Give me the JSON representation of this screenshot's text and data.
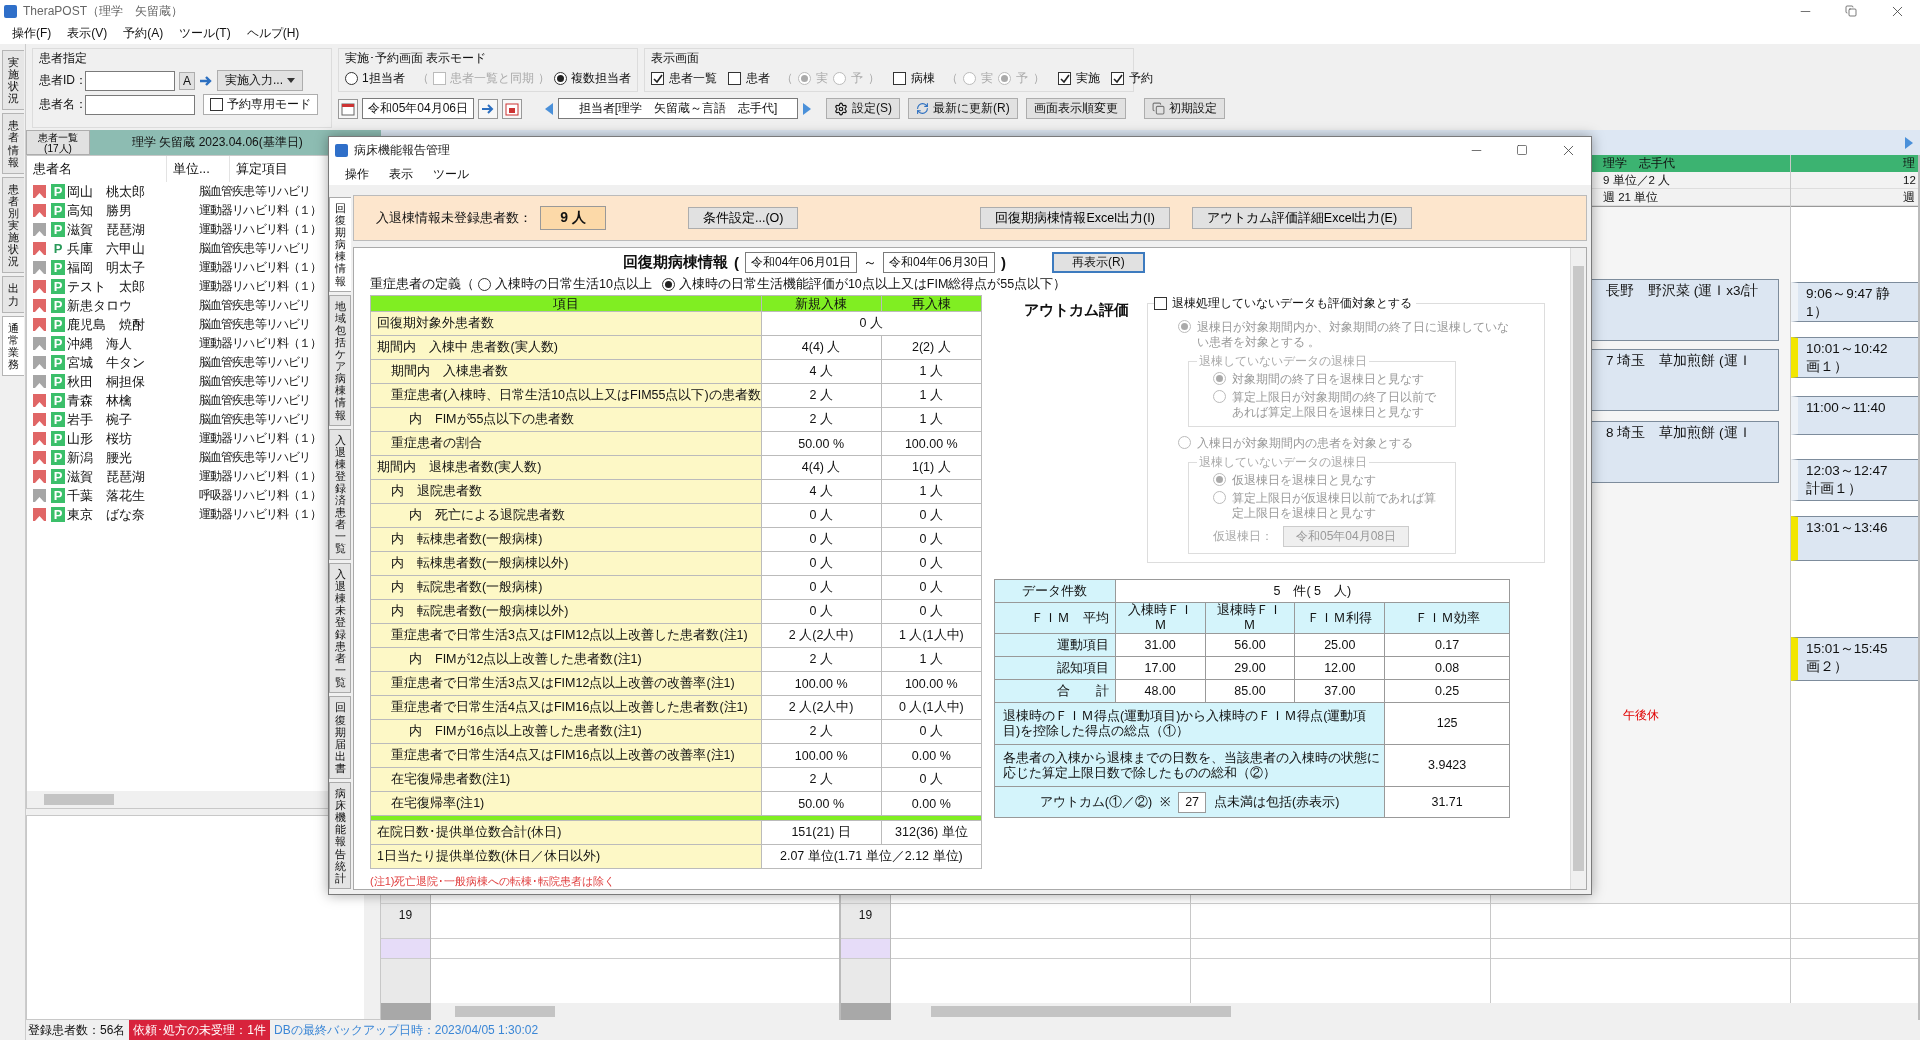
{
  "app_window": {
    "title": "TheraPOST（理学　矢留蔵）"
  },
  "menu": [
    "操作(F)",
    "表示(V)",
    "予約(A)",
    "ツール(T)",
    "ヘルプ(H)"
  ],
  "side_tabs": [
    {
      "label": "実施状況",
      "selected": false
    },
    {
      "label": "患者情報",
      "selected": false
    },
    {
      "label": "患者別実施状況",
      "selected": false
    },
    {
      "label": "出力",
      "selected": false
    },
    {
      "label": "通常業務",
      "selected": true
    }
  ],
  "patient_spec": {
    "legend": "患者指定",
    "id_label": "患者ID：",
    "id_button": "A",
    "input_button": "実施入力...",
    "name_label": "患者名：",
    "reserve_mode": {
      "label": "予約専用モード",
      "checked": false
    }
  },
  "view_mode": {
    "legend": "実施･予約画面 表示モード",
    "single": {
      "label": "1担当者",
      "selected": false
    },
    "sync": {
      "open": "（",
      "label": "患者一覧と同期",
      "close": "）",
      "checked": false,
      "disabled": true
    },
    "multi": {
      "label": "複数担当者",
      "selected": true
    }
  },
  "display": {
    "legend": "表示画面",
    "items": [
      {
        "label": "患者一覧",
        "checked": true
      },
      {
        "label": "患者",
        "checked": false,
        "sub": {
          "open": "（",
          "close": "）",
          "radios": [
            {
              "label": "実",
              "selected": true
            },
            {
              "label": "予",
              "selected": false
            }
          ]
        }
      },
      {
        "label": "病棟",
        "checked": false,
        "sub": {
          "open": "（",
          "close": "）",
          "radios": [
            {
              "label": "実",
              "selected": false
            },
            {
              "label": "予",
              "selected": true
            }
          ]
        }
      },
      {
        "label": "実施",
        "checked": true
      },
      {
        "label": "予約",
        "checked": true
      }
    ]
  },
  "nav": {
    "date": "令和05年04月06日",
    "staff": "担当者[理学　矢留蔵～言語　志手代]",
    "buttons": [
      {
        "label": "設定(S)",
        "kind": "settings"
      },
      {
        "label": "最新に更新(R)",
        "kind": "refresh"
      },
      {
        "label": "画面表示順変更",
        "kind": "plain"
      },
      {
        "label": "初期設定",
        "kind": "reset"
      }
    ]
  },
  "patient_list": {
    "button_lines": [
      "患者一覧",
      "(17人)"
    ],
    "header": "理学 矢留蔵 2023.04.06(基準日)",
    "columns": [
      "患者名",
      "単位...",
      "算定項目"
    ],
    "rows": [
      {
        "color": "#e06666",
        "badge": "P",
        "kind": "filled",
        "name": "岡山　桃太郎",
        "item": "脳血管疾患等リハビリ"
      },
      {
        "color": "#e06666",
        "badge": "P",
        "kind": "filled",
        "name": "高知　勝男",
        "item": "運動器リハビリ料（１）"
      },
      {
        "color": "#a6a6a6",
        "badge": "P",
        "kind": "filled",
        "name": "滋賀　琵琶湖",
        "item": "運動器リハビリ料（１）"
      },
      {
        "color": "#e06666",
        "badge": "P",
        "kind": "plain",
        "name": "兵庫　六甲山",
        "item": "脳血管疾患等リハビリ"
      },
      {
        "color": "#a6a6a6",
        "badge": "P",
        "kind": "filled",
        "name": "福岡　明太子",
        "item": "運動器リハビリ料（１）"
      },
      {
        "color": "#e06666",
        "badge": "P",
        "kind": "filled",
        "name": "テスト　太郎",
        "item": "運動器リハビリ料（１）"
      },
      {
        "color": "#e06666",
        "badge": "P",
        "kind": "filled",
        "name": "新患タロウ",
        "item": "脳血管疾患等リハビリ"
      },
      {
        "color": "#e06666",
        "badge": "P",
        "kind": "filled",
        "name": "鹿児島　焼酎",
        "item": "脳血管疾患等リハビリ"
      },
      {
        "color": "#a6a6a6",
        "badge": "P",
        "kind": "filled",
        "name": "沖縄　海人",
        "item": "運動器リハビリ料（１）"
      },
      {
        "color": "#a6a6a6",
        "badge": "P",
        "kind": "filled",
        "name": "宮城　牛タン",
        "item": "脳血管疾患等リハビリ"
      },
      {
        "color": "#a6a6a6",
        "badge": "P",
        "kind": "filled",
        "name": "秋田　桐担保",
        "item": "脳血管疾患等リハビリ"
      },
      {
        "color": "#e06666",
        "badge": "P",
        "kind": "filled",
        "name": "青森　林檎",
        "item": "脳血管疾患等リハビリ"
      },
      {
        "color": "#e06666",
        "badge": "P",
        "kind": "filled",
        "name": "岩手　椀子",
        "item": "脳血管疾患等リハビリ"
      },
      {
        "color": "#e06666",
        "badge": "P",
        "kind": "filled",
        "name": "山形　桜坊",
        "item": "運動器リハビリ料（１）"
      },
      {
        "color": "#e06666",
        "badge": "P",
        "kind": "filled",
        "name": "新潟　腰光",
        "item": "脳血管疾患等リハビリ"
      },
      {
        "color": "#e06666",
        "badge": "P",
        "kind": "filled",
        "name": "滋賀　琵琶湖",
        "item": "運動器リハビリ料（１）"
      },
      {
        "color": "#a6a6a6",
        "badge": "P",
        "kind": "filled",
        "name": "千葉　落花生",
        "item": "呼吸器リハビリ料（１）"
      },
      {
        "color": "#e06666",
        "badge": "P",
        "kind": "filled",
        "name": "東京　ばな奈",
        "item": "運動器リハビリ料（１）"
      }
    ]
  },
  "schedule": {
    "pane_a": {
      "time": "19"
    },
    "pane_b": {
      "time": "19",
      "columns": [
        {
          "header": "理学　志手代",
          "units": "9 単位／2 人",
          "week": "週 21 単位",
          "note": "午後休",
          "blocks": [
            {
              "lines": [
                "長野　野沢菜 (運Ｉx3/計"
              ]
            },
            {
              "lines": [
                "7 埼玉　草加煎餅 (運Ｉ"
              ]
            },
            {
              "lines": [
                "8 埼玉　草加煎餅 (運Ｉ"
              ]
            }
          ]
        },
        {
          "header": "理",
          "units": "12",
          "week": "週",
          "blocks": [
            {
              "lines": [
                "9:06～9:47 静",
                "1）"
              ],
              "flag": false
            },
            {
              "lines": [
                "10:01～10:42",
                "画１）"
              ],
              "flag": true
            },
            {
              "lines": [
                "11:00～11:40"
              ],
              "flag": false
            },
            {
              "lines": [
                "12:03～12:47",
                "計画１）"
              ],
              "flag": false
            },
            {
              "lines": [
                "13:01～13:46"
              ],
              "flag": true
            },
            {
              "lines": [
                "15:01～15:45",
                "画２）"
              ],
              "flag": true
            }
          ]
        }
      ]
    }
  },
  "status_bar": {
    "count": "登録患者数：56名",
    "alert": "依頼･処方の未受理：1件",
    "backup": "DBの最終バックアップ日時：2023/04/05 1:30:02"
  },
  "dialog": {
    "title": "病床機能報告管理",
    "menu": [
      "操作",
      "表示",
      "ツール"
    ],
    "tabs": [
      {
        "label": "回復期病棟情報",
        "selected": true
      },
      {
        "label": "地域包括ケア病棟情報",
        "selected": false
      },
      {
        "label": "入退棟登録済患者一覧",
        "selected": false
      },
      {
        "label": "入退棟未登録患者一覧",
        "selected": false
      },
      {
        "label": "回復期届出書",
        "selected": false
      },
      {
        "label": "病床機能報告統計",
        "selected": false
      }
    ],
    "unregistered_label": "入退棟情報未登録患者数：",
    "unregistered_count": "9 人",
    "buttons": [
      "条件設定...(O)",
      "回復期病棟情報Excel出力(I)",
      "アウトカム評価詳細Excel出力(E)"
    ],
    "report": {
      "title": "回復期病棟情報",
      "open": "(",
      "from": "令和04年06月01日",
      "tilde": "～",
      "to": "令和04年06月30日",
      "close": ")",
      "refresh": "再表示(R)"
    },
    "definition": {
      "label": "重症患者の定義（",
      "options": [
        {
          "label": "入棟時の日常生活10点以上",
          "selected": false
        },
        {
          "label": "入棟時の日常生活機能評価が10点以上又はFIM総得点が55点以下）",
          "selected": true
        }
      ]
    },
    "table": {
      "columns": [
        "項目",
        "新規入棟",
        "再入棟"
      ],
      "rows": [
        {
          "label": "回復期対象外患者数",
          "values": [
            "0 人"
          ]
        },
        {
          "label": "期間内　入棟中 患者数(実人数)",
          "values": [
            "4(4) 人",
            "2(2) 人"
          ],
          "children": [
            {
              "label": "期間内　入棟患者数",
              "values": [
                "4 人",
                "1 人"
              ]
            },
            {
              "label": "重症患者(入棟時、日常生活10点以上又はFIM55点以下)の患者数",
              "values": [
                "2 人",
                "1 人"
              ],
              "children": [
                {
                  "label": "内　FIMが55点以下の患者数",
                  "values": [
                    "2 人",
                    "1 人"
                  ]
                }
              ]
            },
            {
              "label": "重症患者の割合",
              "values": [
                "50.00 %",
                "100.00 %"
              ]
            }
          ]
        },
        {
          "label": "期間内　退棟患者数(実人数)",
          "values": [
            "4(4) 人",
            "1(1) 人"
          ],
          "children": [
            {
              "label": "内　退院患者数",
              "values": [
                "4 人",
                "1 人"
              ],
              "children": [
                {
                  "label": "内　死亡による退院患者数",
                  "values": [
                    "0 人",
                    "0 人"
                  ]
                }
              ]
            },
            {
              "label": "内　転棟患者数(一般病棟)",
              "values": [
                "0 人",
                "0 人"
              ]
            },
            {
              "label": "内　転棟患者数(一般病棟以外)",
              "values": [
                "0 人",
                "0 人"
              ]
            },
            {
              "label": "内　転院患者数(一般病棟)",
              "values": [
                "0 人",
                "0 人"
              ]
            },
            {
              "label": "内　転院患者数(一般病棟以外)",
              "values": [
                "0 人",
                "0 人"
              ]
            },
            {
              "label": "重症患者で日常生活3点又はFIM12点以上改善した患者数(注1)",
              "values": [
                "2 人(2人中)",
                "1 人(1人中)"
              ],
              "children": [
                {
                  "label": "内　FIMが12点以上改善した患者数(注1)",
                  "values": [
                    "2 人",
                    "1 人"
                  ]
                }
              ]
            },
            {
              "label": "重症患者で日常生活3点又はFIM12点以上改善の改善率(注1)",
              "values": [
                "100.00 %",
                "100.00 %"
              ]
            },
            {
              "label": "重症患者で日常生活4点又はFIM16点以上改善した患者数(注1)",
              "values": [
                "2 人(2人中)",
                "0 人(1人中)"
              ],
              "children": [
                {
                  "label": "内　FIMが16点以上改善した患者数(注1)",
                  "values": [
                    "2 人",
                    "0 人"
                  ]
                }
              ]
            },
            {
              "label": "重症患者で日常生活4点又はFIM16点以上改善の改善率(注1)",
              "values": [
                "100.00 %",
                "0.00 %"
              ]
            },
            {
              "label": "在宅復帰患者数(注1)",
              "values": [
                "2 人",
                "0 人"
              ]
            },
            {
              "label": "在宅復帰率(注1)",
              "values": [
                "50.00 %",
                "0.00 %"
              ]
            }
          ]
        }
      ],
      "totals": [
        {
          "label": "在院日数･提供単位数合計(休日)",
          "values": [
            "151(21) 日",
            "312(36) 単位"
          ]
        },
        {
          "label": "1日当たり提供単位数(休日／休日以外)",
          "values": [
            "2.07 単位(1.71 単位／2.12 単位)"
          ]
        }
      ]
    },
    "footnote": "(注1)死亡退院･一般病棟への転棟･転院患者は除く",
    "outcome": {
      "title": "アウトカム評価",
      "include": {
        "label": "退棟処理していないデータも評価対象とする",
        "checked": false
      },
      "disabled": true,
      "options": [
        {
          "label": "退棟日が対象期間内か、対象期間の終了日に退棟していない患者を対象とする 。",
          "selected": true,
          "group": {
            "legend": "退棟していないデータの退棟日",
            "options": [
              {
                "label": "対象期間の終了日を退棟日と見なす",
                "selected": true
              },
              {
                "label": "算定上限日が対象期間の終了日以前であれば算定上限日を退棟日と見なす",
                "selected": false
              }
            ]
          }
        },
        {
          "label": "入棟日が対象期間内の患者を対象とする",
          "selected": false,
          "group": {
            "legend": "退棟していないデータの退棟日",
            "options": [
              {
                "label": "仮退棟日を退棟日と見なす",
                "selected": true
              },
              {
                "label": "算定上限日が仮退棟日以前であれば算定上限日を退棟日と見なす",
                "selected": false
              }
            ],
            "date_label": "仮退棟日：",
            "date": "令和05年04月08日"
          }
        }
      ]
    },
    "fim": {
      "count_label": "データ件数",
      "count": "5　件( 5　人)",
      "columns": [
        "ＦＩＭ　平均",
        "入棟時ＦＩＭ",
        "退棟時ＦＩＭ",
        "ＦＩＭ利得",
        "ＦＩＭ効率"
      ],
      "rows": [
        {
          "label": "運動項目",
          "values": [
            "31.00",
            "56.00",
            "25.00",
            "0.17"
          ]
        },
        {
          "label": "認知項目",
          "values": [
            "17.00",
            "29.00",
            "12.00",
            "0.08"
          ]
        },
        {
          "label": "合　　計",
          "values": [
            "48.00",
            "85.00",
            "37.00",
            "0.25"
          ]
        }
      ],
      "summary": [
        {
          "label": "退棟時のＦＩＭ得点(運動項目)から入棟時のＦＩＭ得点(運動項目)を控除した得点の総点（①）",
          "value": "125"
        },
        {
          "label": "各患者の入棟から退棟までの日数を、当該患者の入棟時の状態に応じた算定上限日数で除したものの総和（②）",
          "value": "3.9423"
        }
      ],
      "outcome_row": {
        "label": "アウトカム(①／②)",
        "mark": "※",
        "threshold": "27",
        "suffix": "点未満は包括(赤表示)",
        "value": "31.71"
      }
    }
  }
}
